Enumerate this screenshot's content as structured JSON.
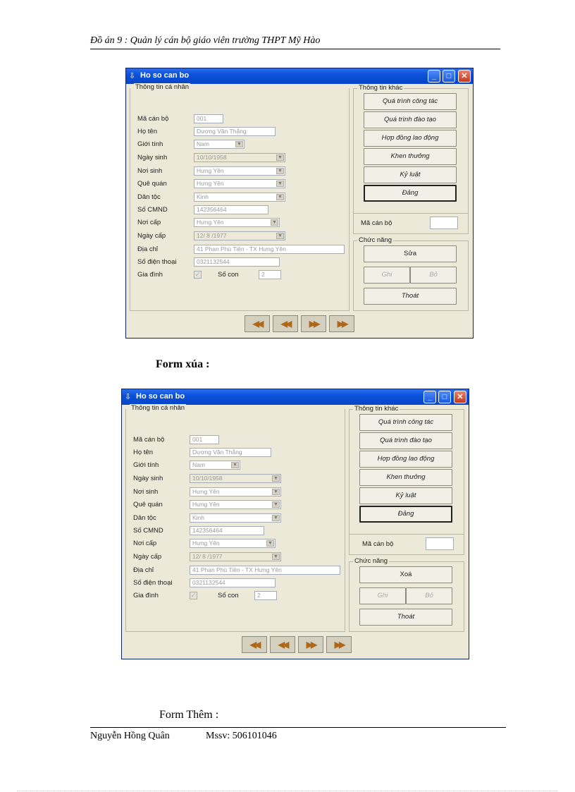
{
  "doc": {
    "header": "Đồ án 9 : Quản lý cán bộ giáo viên trường THPT Mỹ Hào",
    "caption_delete": "Form xúa :",
    "caption_add": "Form Thêm :",
    "footer_name": "Nguyễn  Hồng  Quân",
    "footer_mssv": "Mssv:  506101046"
  },
  "window": {
    "title": "Ho so can bo",
    "min_glyph": "_",
    "max_glyph": "□",
    "close_glyph": "✕",
    "app_icon_glyph": "⇩"
  },
  "personal": {
    "group_title": "Thông tin cá nhân",
    "fields": [
      {
        "label": "Mã cán bộ",
        "value": "001"
      },
      {
        "label": "Họ tên",
        "value": "Dương Văn Thắng"
      },
      {
        "label": "Giới tính",
        "value": "Nam"
      },
      {
        "label": "Ngày sinh",
        "value": "10/10/1958"
      },
      {
        "label": "Nơi sinh",
        "value": "Hưng Yên"
      },
      {
        "label": "Quê quán",
        "value": "Hưng Yên"
      },
      {
        "label": "Dân tộc",
        "value": "Kinh"
      },
      {
        "label": "Số CMND",
        "value": "142356464"
      },
      {
        "label": "Nơi cấp",
        "value": "Hưng Yên"
      },
      {
        "label": "Ngày cấp",
        "value": "12/ 8 /1977"
      },
      {
        "label": "Địa chỉ",
        "value": "41 Phan Phù Tiên - TX Hưng Yên"
      },
      {
        "label": "Số điện thoại",
        "value": "0321132544"
      },
      {
        "label": "Gia đình",
        "value": ""
      }
    ],
    "socon_label": "Số con",
    "socon_value": "2",
    "check_glyph": "✓"
  },
  "other": {
    "group_title": "Thông tin khác",
    "buttons": [
      "Quá trình công tác",
      "Quá trình đào tạo",
      "Hợp đồng lao động",
      "Khen thưởng",
      "Kỷ luật",
      "Đảng"
    ]
  },
  "macanbo": {
    "label": "Mã cán bộ"
  },
  "functions": {
    "group_title": "Chức năng",
    "edit_label": "Sửa",
    "delete_label": "Xoá",
    "save_label": "Ghi",
    "skip_label": "Bỏ",
    "exit_label": "Thoát"
  },
  "nav": {
    "first": "◀◀",
    "prev": "◀◀",
    "next": "▶▶",
    "last": "▶▶"
  }
}
